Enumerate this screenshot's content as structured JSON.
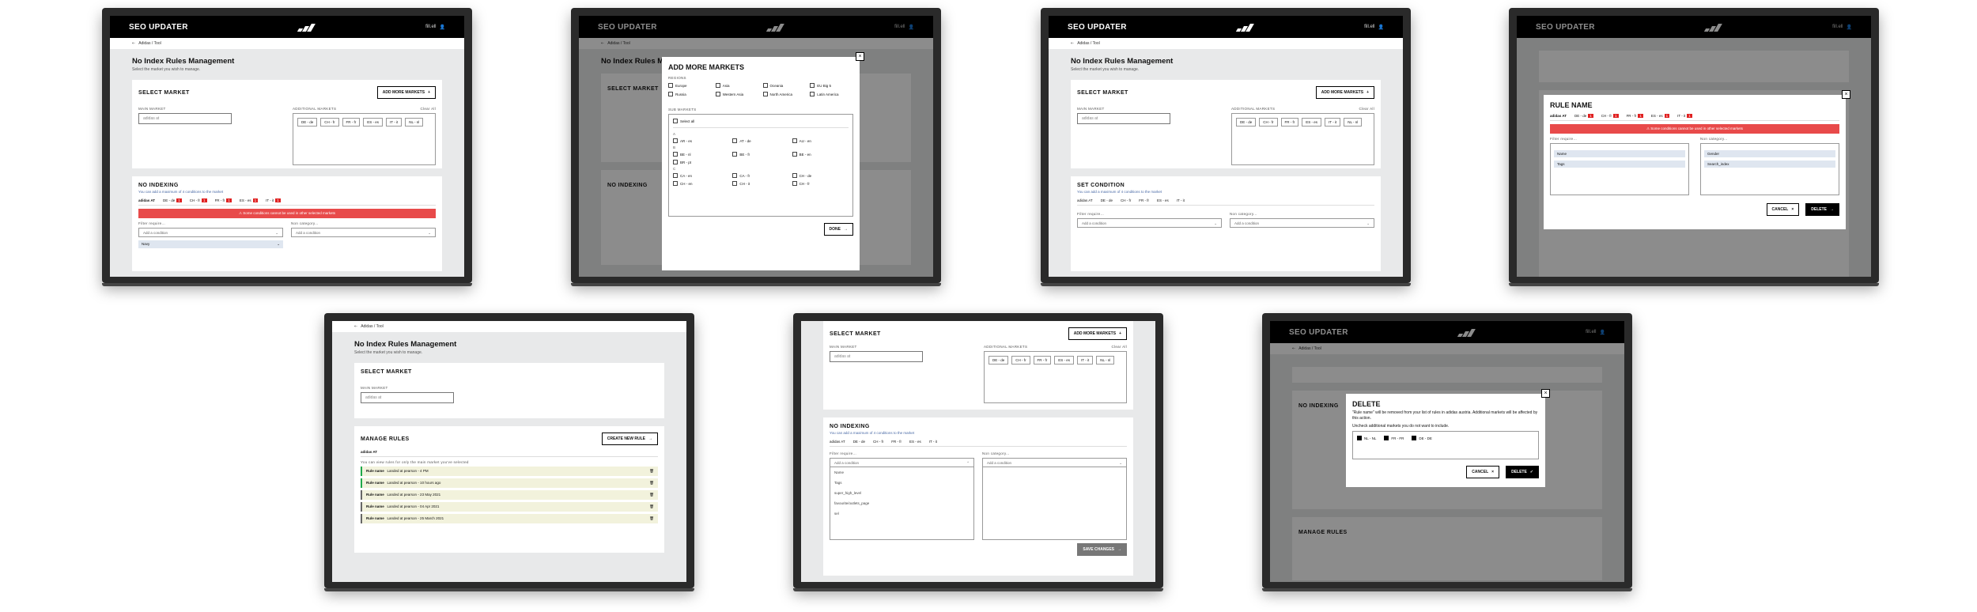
{
  "app": {
    "title": "SEO UPDATER",
    "user": "fill.ell",
    "back_label": "Adidas / Tool"
  },
  "page": {
    "title": "No Index Rules Management",
    "subtitle": "Select the market you wish to manage."
  },
  "select_market": {
    "title": "SELECT MARKET",
    "add_button": "ADD MORE MARKETS",
    "main_label": "MAIN MARKET",
    "additional_label": "ADDITIONAL MARKETS",
    "clear_all": "Clear All",
    "main_value": "adidas at",
    "tags": [
      "DE - de",
      "CH - fr",
      "FR - fr",
      "ES - es",
      "IT - it",
      "NL - nl"
    ]
  },
  "no_indexing": {
    "title": "NO INDEXING",
    "hint": "You can add a maximum of 4 conditions to the market",
    "tabs": [
      "adidas AT",
      "DE - de",
      "CH - fr",
      "FR - fr",
      "ES - es",
      "IT - it"
    ],
    "tab_errors": [
      "1",
      "1",
      "1",
      "1",
      "1",
      "1"
    ],
    "alert": "Some conditions cannot be used in other selected markets",
    "filter_label": "Filter require...",
    "nonfilter_label": "Non category...",
    "add_condition": "Add a condition",
    "chip": "Navy",
    "save": "SAVE CHANGES"
  },
  "set_condition": {
    "title": "SET CONDITION",
    "hint": "You can add a maximum of 4 conditions to the market"
  },
  "add_markets_modal": {
    "title": "ADD MORE MARKETS",
    "regions_label": "REGIONS",
    "regions": [
      "Europe",
      "Asia",
      "Oceania",
      "EU Big 5",
      "Russia",
      "Western Asia",
      "North America",
      "Latin America"
    ],
    "submarkets_label": "SUB MARKETS",
    "select_all": "Select all",
    "groups": [
      {
        "letter": "A",
        "items": [
          "AR - es",
          "AT - de",
          "AU - en"
        ]
      },
      {
        "letter": "B",
        "items": [
          "BE - nl",
          "BE - fr",
          "BE - en",
          "BR - pt"
        ]
      },
      {
        "letter": "C",
        "items": [
          "CA - en",
          "CA - fr",
          "CH - de",
          "CH - en",
          "CH - it",
          "CH - fr",
          "CL - es",
          "CO - es",
          "CZ - cs"
        ]
      }
    ],
    "done": "DONE"
  },
  "rule_modal": {
    "title": "RULE NAME",
    "tabs": [
      "adidas AT",
      "DE - de",
      "CH - fr",
      "FR - fr",
      "ES - es",
      "IT - it"
    ],
    "alert": "Some conditions cannot be used in other selected markets",
    "filter_label": "Filter require...",
    "nonfilter_label": "Non category...",
    "filter_chips": [
      "Name",
      "Tags"
    ],
    "nonfilter_chips": [
      "Gender",
      "Search_index"
    ],
    "cancel": "CANCEL",
    "delete": "DELETE"
  },
  "manage_rules": {
    "title": "MANAGE RULES",
    "create": "CREATE NEW RULE",
    "tab": "adidas AT",
    "hint": "You can view rules for only the main market you've selected",
    "rules": [
      {
        "name": "Rule name",
        "desc": "Landed at pearson - 4 PM"
      },
      {
        "name": "Rule name",
        "desc": "Landed at pearson - 10 hours ago"
      },
      {
        "name": "Rule name",
        "desc": "Landed at pearson - 23 May 2021"
      },
      {
        "name": "Rule name",
        "desc": "Landed at pearson - 04 Apr 2021"
      },
      {
        "name": "Rule name",
        "desc": "Landed at pearson - 25 March 2021"
      }
    ]
  },
  "dropdown": {
    "items": [
      "Name",
      "Tags",
      "super_high_level",
      "favourite/outlets_page",
      "sel"
    ]
  },
  "delete_modal": {
    "title": "DELETE",
    "text": "\"Rule name\" will be removed from your list of rules in adidas austria. Additional markets will be affected by this action.",
    "uncheck": "Uncheck additional markets you do not want to include.",
    "markets": [
      "NL - NL",
      "FR - FR",
      "DE - DE"
    ],
    "cancel": "CANCEL",
    "delete": "DELETE"
  }
}
